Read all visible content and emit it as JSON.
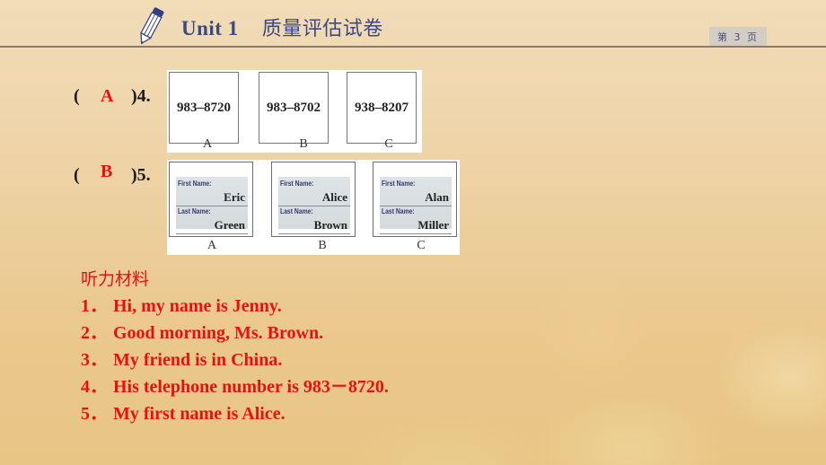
{
  "header": {
    "icon": "pencil-icon",
    "unit": "Unit 1",
    "title_cn": "质量评估试卷",
    "page_badge": "第 3 页"
  },
  "questions": [
    {
      "paren_open": "(",
      "answer": "A",
      "number": ")4.",
      "options": [
        {
          "label": "A",
          "text": "983–8720"
        },
        {
          "label": "B",
          "text": "983–8702"
        },
        {
          "label": "C",
          "text": "938–8207"
        }
      ]
    },
    {
      "paren_open": "(",
      "answer": "B",
      "number": ")5.",
      "field_labels": {
        "first": "First Name:",
        "last": "Last Name:"
      },
      "options": [
        {
          "label": "A",
          "first": "Eric",
          "last": "Green"
        },
        {
          "label": "B",
          "first": "Alice",
          "last": "Brown"
        },
        {
          "label": "C",
          "first": "Alan",
          "last": "Miller"
        }
      ]
    }
  ],
  "script": {
    "title": "听力材料",
    "lines": [
      {
        "num": "1．",
        "text": "Hi, my name is Jenny."
      },
      {
        "num": "2．",
        "text": "Good morning, Ms. Brown."
      },
      {
        "num": "3．",
        "text": "My friend is in China."
      },
      {
        "num": "4．",
        "text": "His telephone number is 983－8720."
      },
      {
        "num": "5．",
        "text": "My first name is Alice."
      }
    ]
  },
  "colors": {
    "title": "#3b4a82",
    "answer": "#e8110f",
    "script": "#e8110f",
    "header_line": "#8a7a66"
  }
}
